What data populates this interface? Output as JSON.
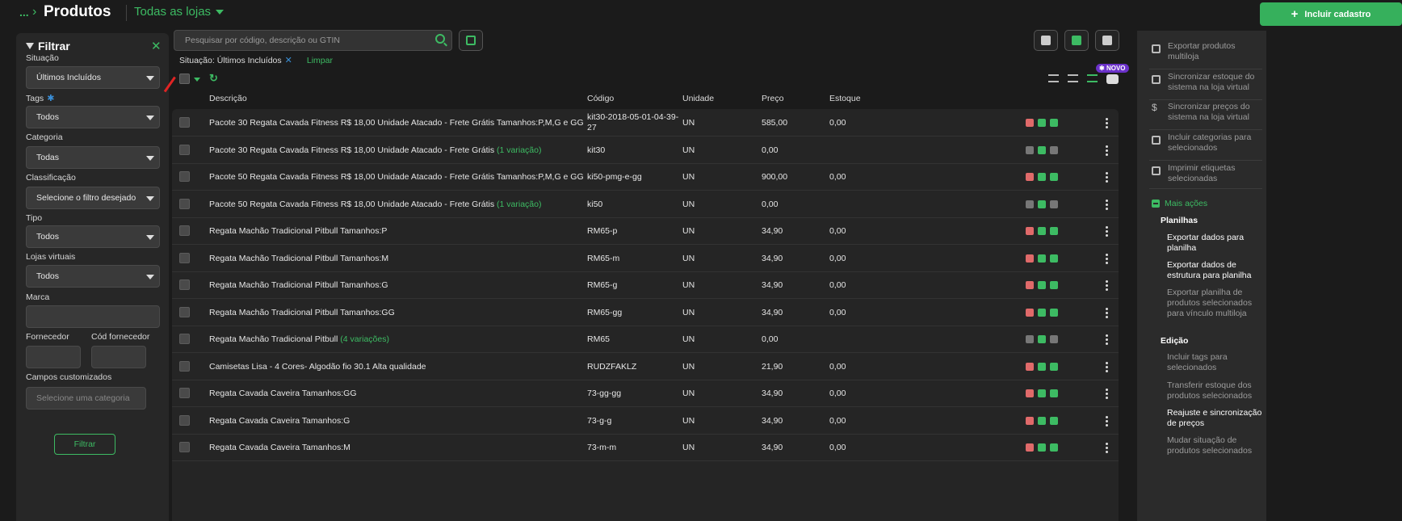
{
  "header": {
    "breadcrumb_dots": "...",
    "title": "Produtos",
    "store_label": "Todas as lojas",
    "add_button": "Incluir cadastro"
  },
  "filter": {
    "title": "Filtrar",
    "fields": {
      "situacao": {
        "label": "Situação",
        "value": "Últimos Incluídos"
      },
      "tags": {
        "label": "Tags",
        "value": "Todos"
      },
      "categoria": {
        "label": "Categoria",
        "value": "Todas"
      },
      "classificacao": {
        "label": "Classificação",
        "value": "Selecione o filtro desejado"
      },
      "tipo": {
        "label": "Tipo",
        "value": "Todos"
      },
      "lojas": {
        "label": "Lojas virtuais",
        "value": "Todos"
      },
      "marca": {
        "label": "Marca",
        "value": ""
      },
      "fornecedor": {
        "label": "Fornecedor",
        "value": ""
      },
      "cod_fornecedor": {
        "label": "Cód fornecedor",
        "value": ""
      },
      "campos": {
        "label": "Campos customizados",
        "placeholder": "Selecione uma categoria"
      }
    },
    "submit": "Filtrar"
  },
  "search": {
    "placeholder": "Pesquisar por código, descrição ou GTIN"
  },
  "active_filter": {
    "text": "Situação: Últimos Incluídos",
    "clear": "Limpar"
  },
  "badge_new": "NOVO",
  "table": {
    "columns": {
      "descricao": "Descrição",
      "codigo": "Código",
      "unidade": "Unidade",
      "preco": "Preço",
      "estoque": "Estoque"
    },
    "rows": [
      {
        "desc": "Pacote 30 Regata Cavada Fitness R$ 18,00 Unidade Atacado - Frete Grátis Tamanhos:P,M,G e GG",
        "var": "",
        "code": "kit30-2018-05-01-04-39-",
        "code2": "27",
        "unit": "UN",
        "price": "585,00",
        "stock": "0,00",
        "active": true
      },
      {
        "desc": "Pacote 30 Regata Cavada Fitness R$ 18,00 Unidade Atacado - Frete Grátis",
        "var": "(1 variação)",
        "code": "kit30",
        "code2": "",
        "unit": "UN",
        "price": "0,00",
        "stock": "",
        "active": false
      },
      {
        "desc": "Pacote 50 Regata Cavada Fitness R$ 18,00 Unidade Atacado - Frete Grátis Tamanhos:P,M,G e GG",
        "var": "",
        "code": "ki50-pmg-e-gg",
        "code2": "",
        "unit": "UN",
        "price": "900,00",
        "stock": "0,00",
        "active": true
      },
      {
        "desc": "Pacote 50 Regata Cavada Fitness R$ 18,00 Unidade Atacado - Frete Grátis",
        "var": "(1 variação)",
        "code": "ki50",
        "code2": "",
        "unit": "UN",
        "price": "0,00",
        "stock": "",
        "active": false
      },
      {
        "desc": "Regata Machão Tradicional Pitbull Tamanhos:P",
        "var": "",
        "code": "RM65-p",
        "code2": "",
        "unit": "UN",
        "price": "34,90",
        "stock": "0,00",
        "active": true
      },
      {
        "desc": "Regata Machão Tradicional Pitbull Tamanhos:M",
        "var": "",
        "code": "RM65-m",
        "code2": "",
        "unit": "UN",
        "price": "34,90",
        "stock": "0,00",
        "active": true
      },
      {
        "desc": "Regata Machão Tradicional Pitbull Tamanhos:G",
        "var": "",
        "code": "RM65-g",
        "code2": "",
        "unit": "UN",
        "price": "34,90",
        "stock": "0,00",
        "active": true
      },
      {
        "desc": "Regata Machão Tradicional Pitbull Tamanhos:GG",
        "var": "",
        "code": "RM65-gg",
        "code2": "",
        "unit": "UN",
        "price": "34,90",
        "stock": "0,00",
        "active": true
      },
      {
        "desc": "Regata Machão Tradicional Pitbull",
        "var": "(4 variações)",
        "code": "RM65",
        "code2": "",
        "unit": "UN",
        "price": "0,00",
        "stock": "",
        "active": false
      },
      {
        "desc": "Camisetas Lisa - 4 Cores- Algodão fio 30.1 Alta qualidade",
        "var": "",
        "code": "RUDZFAKLZ",
        "code2": "",
        "unit": "UN",
        "price": "21,90",
        "stock": "0,00",
        "active": true
      },
      {
        "desc": "Regata Cavada Caveira Tamanhos:GG",
        "var": "",
        "code": "73-gg-gg",
        "code2": "",
        "unit": "UN",
        "price": "34,90",
        "stock": "0,00",
        "active": true
      },
      {
        "desc": "Regata Cavada Caveira Tamanhos:G",
        "var": "",
        "code": "73-g-g",
        "code2": "",
        "unit": "UN",
        "price": "34,90",
        "stock": "0,00",
        "active": true
      },
      {
        "desc": "Regata Cavada Caveira Tamanhos:M",
        "var": "",
        "code": "73-m-m",
        "code2": "",
        "unit": "UN",
        "price": "34,90",
        "stock": "0,00",
        "active": true
      }
    ]
  },
  "right_panel": {
    "actions": [
      {
        "label": "Exportar produtos multiloja",
        "icon": "upload-icon"
      },
      {
        "label": "Sincronizar estoque do sistema na loja virtual",
        "icon": "box-icon"
      },
      {
        "label": "Sincronizar preços do sistema na loja virtual",
        "icon": "dollar-icon"
      },
      {
        "label": "Incluir categorias para selecionados",
        "icon": "hierarchy-icon"
      },
      {
        "label": "Imprimir etiquetas selecionadas",
        "icon": "tag-icon"
      }
    ],
    "more_label": "Mais ações",
    "groups": {
      "planilhas": "Planilhas",
      "edicao": "Edição"
    },
    "links": [
      "Exportar dados para planilha",
      "Exportar dados de estrutura para planilha",
      "Exportar planilha de produtos selecionados para vínculo multiloja",
      "Incluir tags para selecionados",
      "Transferir estoque dos produtos selecionados",
      "Reajuste e sincronização de preços",
      "Mudar situação de produtos selecionados"
    ]
  },
  "colors": {
    "accent": "#3dbb63",
    "cube_active": "#e06a6a",
    "inactive": "#777777",
    "new_badge": "#6b31c9"
  }
}
